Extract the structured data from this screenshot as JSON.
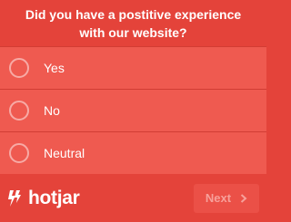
{
  "survey": {
    "question": "Did you have a postitive experience with our website?",
    "options": [
      {
        "label": "Yes",
        "selected": false
      },
      {
        "label": "No",
        "selected": false
      },
      {
        "label": "Neutral",
        "selected": false
      }
    ]
  },
  "footer": {
    "brand_name": "hotjar",
    "brand_icon": "hotjar-logo-icon",
    "next_label": "Next",
    "next_icon": "chevron-right-icon",
    "next_enabled": false
  },
  "colors": {
    "background": "#e4433a",
    "option_background": "#ef5a50",
    "text": "#ffffff"
  }
}
